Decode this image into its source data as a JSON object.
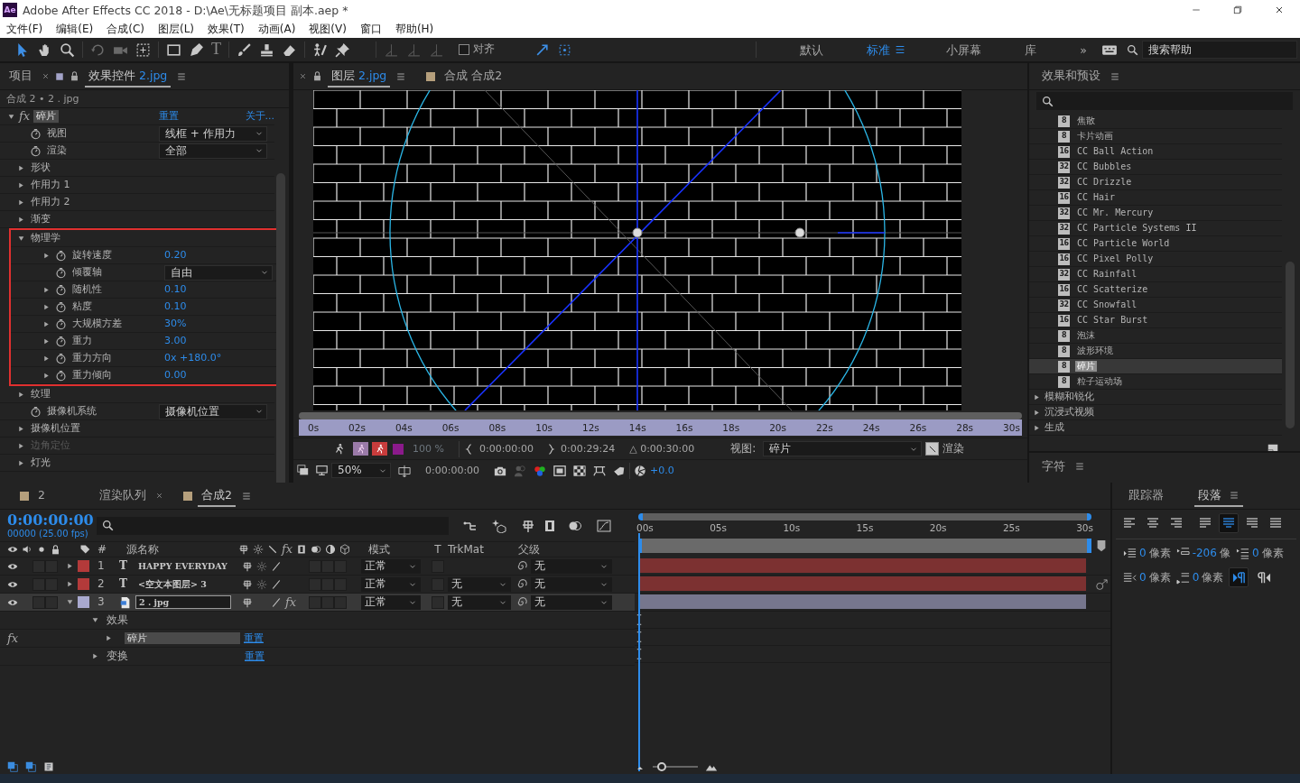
{
  "window": {
    "app_icon": "Ae",
    "title": "Adobe After Effects CC 2018 - D:\\Ae\\无标题项目 副本.aep *"
  },
  "menu": [
    "文件(F)",
    "编辑(E)",
    "合成(C)",
    "图层(L)",
    "效果(T)",
    "动画(A)",
    "视图(V)",
    "窗口",
    "帮助(H)"
  ],
  "toolbar": {
    "text_tool": "T",
    "align": {
      "label": "对齐",
      "checked": false
    },
    "workspaces": [
      {
        "label": "默认",
        "selected": false
      },
      {
        "label": "标准",
        "selected": true
      },
      {
        "label": "小屏幕",
        "selected": false
      },
      {
        "label": "库",
        "selected": false
      }
    ],
    "more": "»",
    "help_search": {
      "placeholder": "搜索帮助"
    }
  },
  "project_panel": {
    "tabs": [
      {
        "label": "项目",
        "selected": false,
        "closable": false
      },
      {
        "label": "效果控件",
        "layer": "2.jpg",
        "selected": true,
        "closable": true
      }
    ]
  },
  "effect_controls": {
    "breadcrumb": "合成 2 • 2 . jpg",
    "fx": "fx",
    "effect_name": "碎片",
    "reset": "重置",
    "about": "关于...",
    "properties": [
      {
        "kind": "dropdown",
        "label": "视图",
        "value": "线框 + 作用力",
        "disabled": false
      },
      {
        "kind": "dropdown",
        "label": "渲染",
        "value": "全部",
        "disabled": false
      },
      {
        "kind": "group",
        "label": "形状",
        "expanded": false,
        "disabled": false
      },
      {
        "kind": "group",
        "label": "作用力 1",
        "expanded": false,
        "disabled": false
      },
      {
        "kind": "group",
        "label": "作用力 2",
        "expanded": false,
        "disabled": false
      },
      {
        "kind": "group",
        "label": "渐变",
        "expanded": false,
        "disabled": false
      },
      {
        "kind": "group",
        "label": "物理学",
        "expanded": true,
        "highlighted": true,
        "disabled": false,
        "children": [
          {
            "kind": "value",
            "label": "旋转速度",
            "value": "0.20",
            "expanded": false
          },
          {
            "kind": "dropdown",
            "label": "倾覆轴",
            "value": "自由"
          },
          {
            "kind": "value",
            "label": "随机性",
            "value": "0.10",
            "expanded": false
          },
          {
            "kind": "value",
            "label": "粘度",
            "value": "0.10",
            "expanded": false
          },
          {
            "kind": "value",
            "label": "大规模方差",
            "value": "30%",
            "expanded": false
          },
          {
            "kind": "value",
            "label": "重力",
            "value": "3.00",
            "expanded": false
          },
          {
            "kind": "value",
            "label": "重力方向",
            "value": "0x +180.0°",
            "expanded": false
          },
          {
            "kind": "value",
            "label": "重力倾向",
            "value": "0.00",
            "expanded": false
          }
        ]
      },
      {
        "kind": "group",
        "label": "纹理",
        "expanded": false,
        "disabled": false
      },
      {
        "kind": "dropdown",
        "label": "摄像机系统",
        "value": "摄像机位置",
        "disabled": false
      },
      {
        "kind": "group",
        "label": "摄像机位置",
        "expanded": false,
        "disabled": false
      },
      {
        "kind": "group",
        "label": "边角定位",
        "expanded": false,
        "disabled": true
      },
      {
        "kind": "group",
        "label": "灯光",
        "expanded": false,
        "disabled": false
      }
    ]
  },
  "viewer": {
    "tabs": [
      {
        "label": "图层",
        "layer": "2.jpg",
        "selected": true,
        "closable": true
      },
      {
        "label": "合成 合成2",
        "selected": false,
        "closable": false
      }
    ],
    "ruler": [
      "0s",
      "02s",
      "04s",
      "06s",
      "08s",
      "10s",
      "12s",
      "14s",
      "16s",
      "18s",
      "20s",
      "22s",
      "24s",
      "26s",
      "28s",
      "30s"
    ],
    "controls": {
      "resolution": "100 %",
      "in_time": "0:00:00:00",
      "out_time": "0:00:29:24",
      "duration": "△ 0:00:30:00",
      "view_label": "视图:",
      "view_value": "碎片",
      "render_label": "渲染",
      "render_checked": true,
      "zoom": "50%",
      "current_time": "0:00:00:00",
      "exposure": "+0.0"
    }
  },
  "effects_presets": {
    "title": "效果和预设",
    "items": [
      {
        "bits": "8",
        "name": "焦散",
        "selected": false
      },
      {
        "bits": "8",
        "name": "卡片动画",
        "selected": false
      },
      {
        "bits": "16",
        "name": "CC Ball Action",
        "selected": false
      },
      {
        "bits": "32",
        "name": "CC Bubbles",
        "selected": false
      },
      {
        "bits": "32",
        "name": "CC Drizzle",
        "selected": false
      },
      {
        "bits": "16",
        "name": "CC Hair",
        "selected": false
      },
      {
        "bits": "32",
        "name": "CC Mr. Mercury",
        "selected": false
      },
      {
        "bits": "32",
        "name": "CC Particle Systems II",
        "selected": false
      },
      {
        "bits": "16",
        "name": "CC Particle World",
        "selected": false
      },
      {
        "bits": "16",
        "name": "CC Pixel Polly",
        "selected": false
      },
      {
        "bits": "32",
        "name": "CC Rainfall",
        "selected": false
      },
      {
        "bits": "16",
        "name": "CC Scatterize",
        "selected": false
      },
      {
        "bits": "32",
        "name": "CC Snowfall",
        "selected": false
      },
      {
        "bits": "16",
        "name": "CC Star Burst",
        "selected": false
      },
      {
        "bits": "8",
        "name": "泡沫",
        "selected": false
      },
      {
        "bits": "8",
        "name": "波形环境",
        "selected": false
      },
      {
        "bits": "8",
        "name": "碎片",
        "selected": true
      },
      {
        "bits": "8",
        "name": "粒子运动场",
        "selected": false
      }
    ],
    "categories": [
      {
        "label": "模糊和锐化",
        "expanded": false
      },
      {
        "label": "沉浸式视频",
        "expanded": false
      },
      {
        "label": "生成",
        "expanded": false
      }
    ]
  },
  "character_panel": {
    "title": "字符"
  },
  "timeline": {
    "tabs": [
      {
        "kind": "comp",
        "label": "2",
        "selected": false,
        "closable": false
      },
      {
        "kind": "queue",
        "label": "渲染队列",
        "selected": false,
        "closable": false
      },
      {
        "kind": "comp",
        "label": "合成2",
        "selected": true,
        "closable": true
      }
    ],
    "current_time": "0:00:00:00",
    "frame_info": "00000 (25.00 fps)",
    "columns": {
      "number": "#",
      "source_name": "源名称",
      "fx": "fx",
      "mode": "模式",
      "t": "T",
      "trkmat": "TrkMat",
      "parent": "父级"
    },
    "layers": [
      {
        "number": "1",
        "kind": "text",
        "type_glyph": "T",
        "name": "HAPPY EVERYDAY",
        "color": "#b33a3a",
        "mode": "正常",
        "parent": "无",
        "expanded": false,
        "selected": false
      },
      {
        "number": "2",
        "kind": "text",
        "type_glyph": "T",
        "name": "<空文本图层> 3",
        "color": "#b33a3a",
        "mode": "正常",
        "trkmat": "无",
        "parent": "无",
        "expanded": false,
        "selected": false
      },
      {
        "number": "3",
        "kind": "image",
        "name": "2 . jpg",
        "color": "#a9a9cf",
        "fx": "fx",
        "mode": "正常",
        "trkmat": "无",
        "parent": "无",
        "expanded": true,
        "selected": true,
        "children": [
          {
            "label": "效果",
            "expanded": true,
            "children": [
              {
                "fx": "fx",
                "label": "碎片",
                "reset": "重置",
                "expanded": false
              }
            ]
          },
          {
            "label": "变换",
            "reset": "重置",
            "expanded": false
          }
        ]
      }
    ],
    "ruler": [
      "00s",
      "05s",
      "10s",
      "15s",
      "20s",
      "25s",
      "30s"
    ],
    "zoom": {
      "level": 0.12
    }
  },
  "paragraph_panel": {
    "tabs": [
      {
        "label": "跟踪器",
        "selected": false
      },
      {
        "label": "段落",
        "selected": true
      }
    ],
    "alignments": [
      {
        "kind": "left",
        "selected": false
      },
      {
        "kind": "center",
        "selected": false
      },
      {
        "kind": "right",
        "selected": false
      },
      {
        "kind": "justify-left",
        "selected": false
      },
      {
        "kind": "justify-center",
        "selected": true
      },
      {
        "kind": "justify-right",
        "selected": false
      },
      {
        "kind": "justify-all",
        "selected": false
      }
    ],
    "fields": [
      {
        "kind": "indent-left",
        "value": "0",
        "unit": "像素"
      },
      {
        "kind": "first-line",
        "value": "-206",
        "unit": "像"
      },
      {
        "kind": "space-before",
        "value": "0",
        "unit": "像素"
      },
      {
        "kind": "indent-right",
        "value": "0",
        "unit": "像素"
      },
      {
        "kind": "space-after",
        "value": "0",
        "unit": "像素"
      }
    ],
    "directions": [
      {
        "kind": "ltr",
        "selected": true
      },
      {
        "kind": "rtl",
        "selected": false
      }
    ]
  }
}
